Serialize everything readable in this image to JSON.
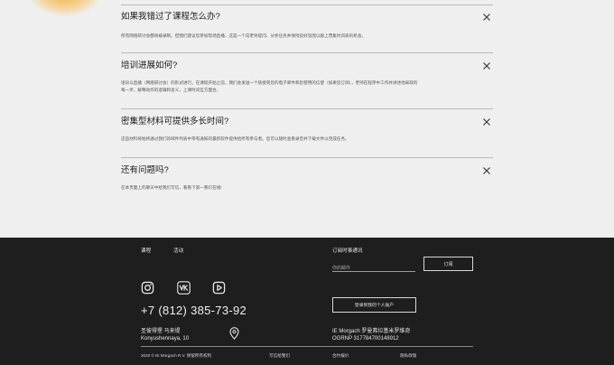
{
  "faq": [
    {
      "question": "如果我错过了课程怎么办?",
      "answer": "所有网络研讨会都将被录制。但我们建议您参加现场直播，这是一个向老师提问、分析任务并保持良好氛围以跟上营集时间表的机会。"
    },
    {
      "question": "培训进展如何?",
      "answer1": "培训以直播（网络研讨会）的形式进行。在课程开始之前，我们会发送一个链接到您的电子邮件和您使用的信使（如果您订阅），老师在程序中工作并讲述他采取的",
      "answer2": "每一步，解释动作的逻辑和含义，上课时间互方面合。"
    },
    {
      "question": "密集型材料可提供多长时间?",
      "answer": "这些材料将始终通过我们的邮件列表中带有通知的最新软件提供给所有参与者。您可以随时查看录音并下载文件以完成任务。"
    },
    {
      "question": "还有问题吗?",
      "answer": "在本页面上的聊天中给我们写信，看看下第一我们在线!"
    }
  ],
  "footer": {
    "nav": [
      "课程",
      "活动"
    ],
    "subscribe_label": "订阅时事通讯",
    "email_placeholder": "你的邮件",
    "subscribe_button": "订阅",
    "social": [
      "instagram-icon",
      "vk-icon",
      "youtube-icon"
    ],
    "phone": "+7 (812) 385-73-92",
    "account_button": "登录到我的个人账户",
    "address": "圣彼得堡 马来堤 Konyushennaya, 10",
    "company_line1": "IE Morgach 罗曼弗拉基米罗维奇",
    "company_line2": "OGRNP 317784700148912",
    "bottom": [
      "2020 © IE Morgach R.V. 保留所有权利",
      "写信给我们",
      "合约报价",
      "隐私政策"
    ]
  },
  "colors": {
    "background": "#efefef",
    "footer_background": "#1e1e1e",
    "accent_blob": "#f6aa32"
  }
}
